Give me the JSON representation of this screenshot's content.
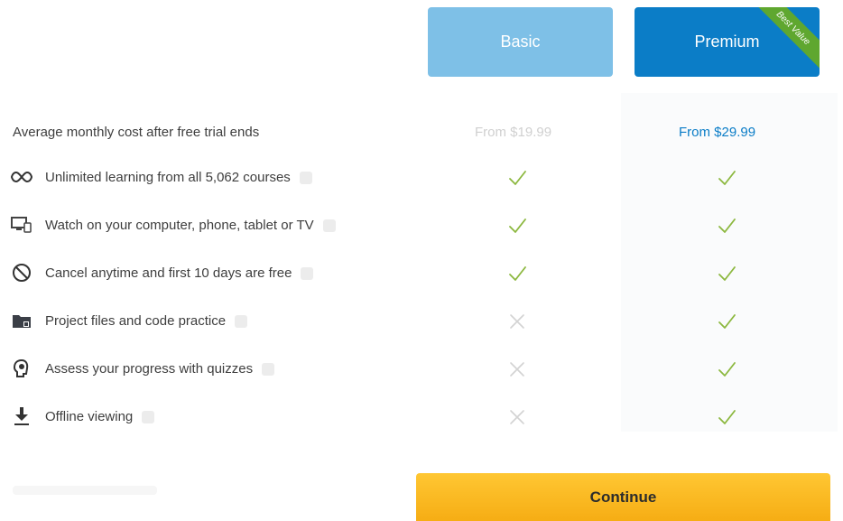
{
  "plans": {
    "basic": {
      "label": "Basic"
    },
    "premium": {
      "label": "Premium",
      "badge": "Best Value"
    }
  },
  "header_row": {
    "label": "Average monthly cost after free trial ends",
    "basic_price": "From $19.99",
    "premium_price": "From $29.99"
  },
  "features": [
    {
      "icon": "infinity-icon",
      "label": "Unlimited learning from all 5,062 courses",
      "basic": true,
      "premium": true
    },
    {
      "icon": "devices-icon",
      "label": "Watch on your computer, phone, tablet or TV",
      "basic": true,
      "premium": true
    },
    {
      "icon": "cancel-icon",
      "label": "Cancel anytime and first 10 days are free",
      "basic": true,
      "premium": true
    },
    {
      "icon": "folder-icon",
      "label": "Project files and code practice",
      "basic": false,
      "premium": true
    },
    {
      "icon": "quiz-head-icon",
      "label": "Assess your progress with quizzes",
      "basic": false,
      "premium": true
    },
    {
      "icon": "download-icon",
      "label": "Offline viewing",
      "basic": false,
      "premium": true
    }
  ],
  "colors": {
    "check": "#8cb83f",
    "cross": "#d3d3d3",
    "basic_button": "#7ec0e7",
    "premium_button": "#0b7dc7",
    "badge": "#5fa72f",
    "continue": "#f6ad14"
  },
  "continue_label": "Continue"
}
